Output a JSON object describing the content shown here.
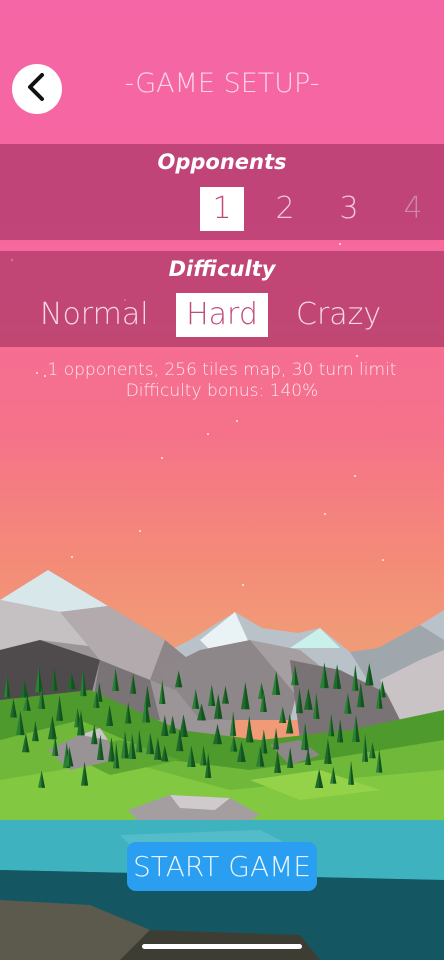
{
  "header": {
    "title": "-GAME SETUP-",
    "back_icon": "chevron-left-icon"
  },
  "opponents": {
    "label": "Opponents",
    "options": [
      "1",
      "2",
      "3",
      "4"
    ],
    "selected": "1"
  },
  "difficulty": {
    "label": "Difficulty",
    "options": [
      "Normal",
      "Hard",
      "Crazy"
    ],
    "selected": "Hard"
  },
  "info": {
    "line1": "1 opponents, 256 tiles map, 30 turn limit",
    "line2": "Difficulty bonus: 140%"
  },
  "start_label": "START GAME",
  "colors": {
    "accent": "#2a9ef0",
    "band": "#96285a",
    "sky_top": "#f566a6"
  }
}
